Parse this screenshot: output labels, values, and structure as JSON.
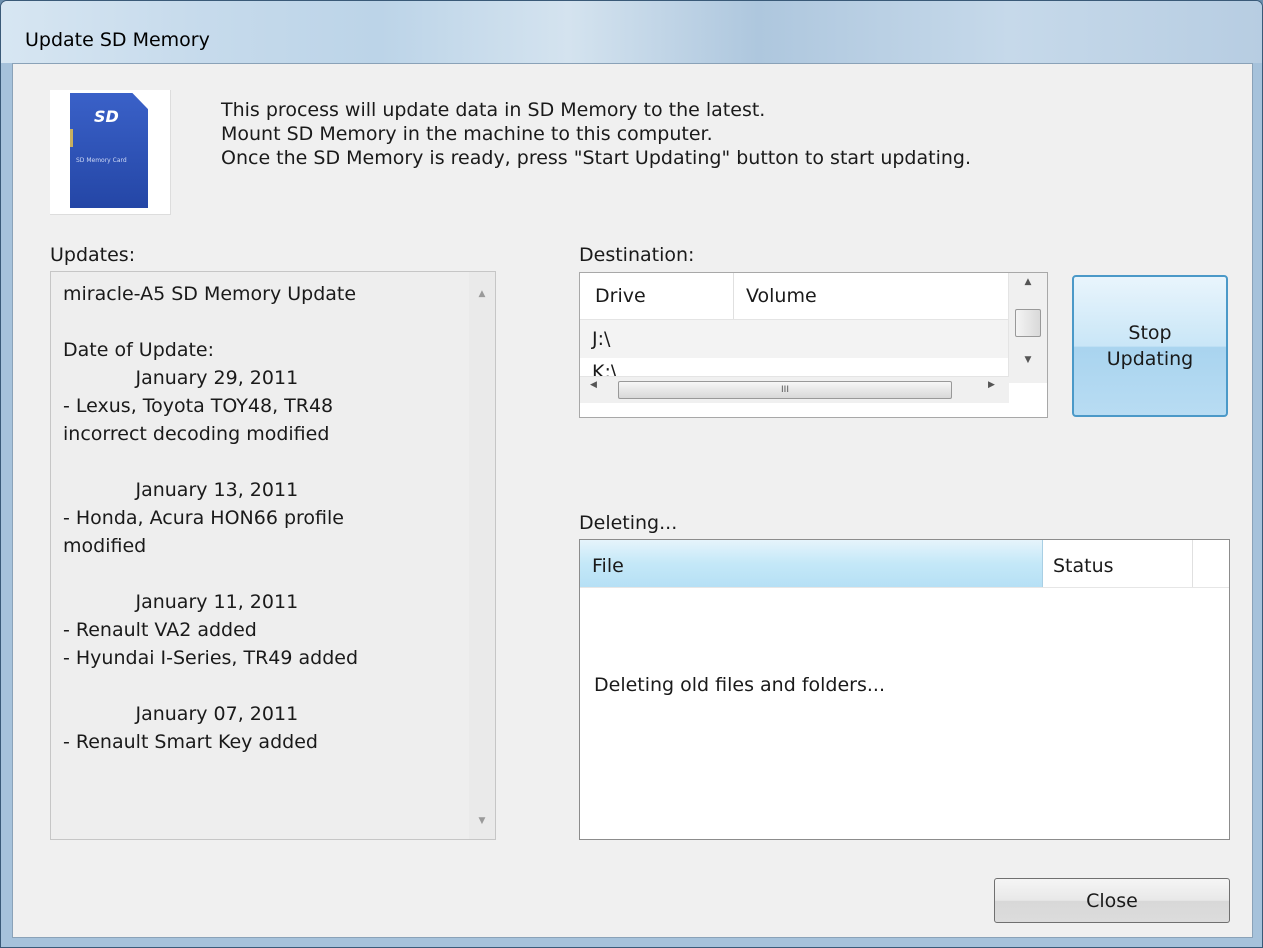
{
  "window": {
    "title": "Update SD Memory"
  },
  "sd_card_icon": {
    "logo_text": "SD",
    "small_text": "SD Memory Card"
  },
  "intro": {
    "line1": "This process will update data in SD Memory to the latest.",
    "line2": "Mount SD Memory in the machine to this computer.",
    "line3": "Once the SD Memory is ready, press \"Start Updating\" button to start updating."
  },
  "updates": {
    "label": "Updates:",
    "lines": [
      "miracle-A5 SD Memory Update",
      "",
      "Date of Update:",
      "            January 29, 2011",
      "- Lexus, Toyota TOY48, TR48",
      "incorrect decoding modified",
      "",
      "            January 13, 2011",
      "- Honda, Acura HON66 profile",
      "modified",
      "",
      "            January 11, 2011",
      "- Renault VA2 added",
      "- Hyundai I-Series, TR49 added",
      "",
      "            January 07, 2011",
      "- Renault Smart Key added"
    ]
  },
  "destination": {
    "label": "Destination:",
    "columns": [
      "Drive",
      "Volume"
    ],
    "rows": [
      {
        "drive": "J:\\",
        "volume": ""
      },
      {
        "drive": "K:\\",
        "volume": ""
      }
    ],
    "hscroll_grip": "III"
  },
  "stop_button": {
    "line1": "Stop",
    "line2": "Updating"
  },
  "deleting": {
    "label": "Deleting...",
    "columns": [
      "File",
      "Status"
    ],
    "message": "Deleting old files and folders..."
  },
  "close_button": {
    "label": "Close"
  },
  "colors": {
    "button_hot": "#a9d4ef",
    "header_selected": "#c4e8f8",
    "accent": "#4b99c8"
  }
}
